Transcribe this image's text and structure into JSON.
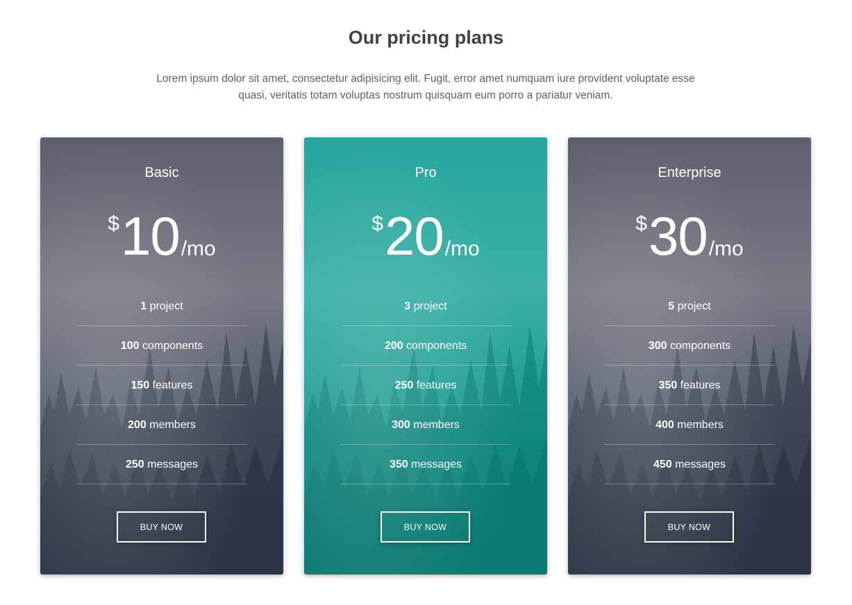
{
  "heading": "Our pricing plans",
  "intro": "Lorem ipsum dolor sit amet, consectetur adipisicing elit. Fugit, error amet numquam iure provident voluptate esse quasi, veritatis totam voluptas nostrum quisquam eum porro a pariatur veniam.",
  "colors": {
    "basic_top": "#6b6f7a",
    "basic_bottom": "#3a4352",
    "pro_top": "#2aa79e",
    "pro_bottom": "#0f8a80",
    "title_text": "#424242",
    "body_text": "#616161"
  },
  "plans": [
    {
      "name": "Basic",
      "currency": "$",
      "amount": "10",
      "period": "/mo",
      "features": [
        {
          "value": "1",
          "label": "project"
        },
        {
          "value": "100",
          "label": "components"
        },
        {
          "value": "150",
          "label": "features"
        },
        {
          "value": "200",
          "label": "members"
        },
        {
          "value": "250",
          "label": "messages"
        }
      ],
      "button": "BUY NOW"
    },
    {
      "name": "Pro",
      "currency": "$",
      "amount": "20",
      "period": "/mo",
      "features": [
        {
          "value": "3",
          "label": "project"
        },
        {
          "value": "200",
          "label": "components"
        },
        {
          "value": "250",
          "label": "features"
        },
        {
          "value": "300",
          "label": "members"
        },
        {
          "value": "350",
          "label": "messages"
        }
      ],
      "button": "BUY NOW"
    },
    {
      "name": "Enterprise",
      "currency": "$",
      "amount": "30",
      "period": "/mo",
      "features": [
        {
          "value": "5",
          "label": "project"
        },
        {
          "value": "300",
          "label": "components"
        },
        {
          "value": "350",
          "label": "features"
        },
        {
          "value": "400",
          "label": "members"
        },
        {
          "value": "450",
          "label": "messages"
        }
      ],
      "button": "BUY NOW"
    }
  ]
}
